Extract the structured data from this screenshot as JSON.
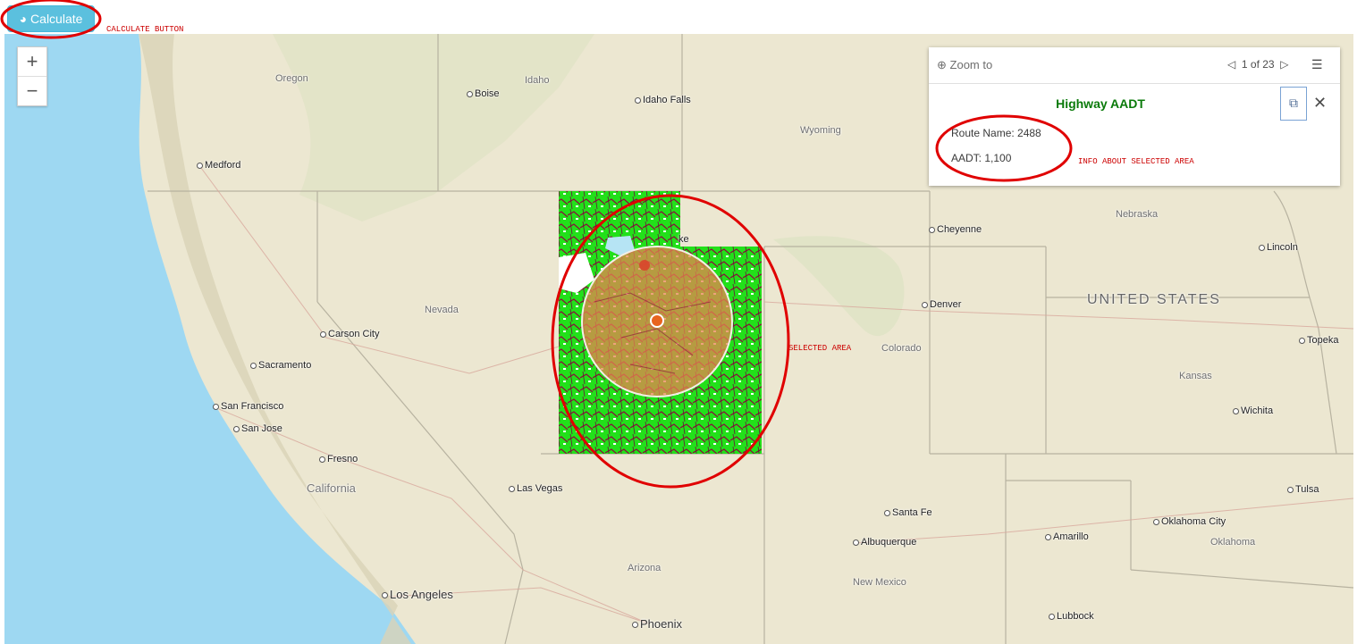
{
  "toolbar": {
    "calculate_label": "Calculate",
    "calculate_icon": "globe-icon"
  },
  "annotations": {
    "calculate_button": "CALCULATE BUTTON",
    "info": "INFO ABOUT SELECTED AREA",
    "selected_area": "SELECTED AREA"
  },
  "zoom": {
    "in": "+",
    "out": "−"
  },
  "popup": {
    "zoom_to": "Zoom to",
    "pager": "1 of 23",
    "title": "Highway AADT",
    "route_name": "Route Name: 2488",
    "aadt": "AADT: 1,100"
  },
  "map": {
    "country": "UNITED STATES",
    "states": [
      "Oregon",
      "Idaho",
      "Wyoming",
      "Nevada",
      "Nebraska",
      "Colorado",
      "Kansas",
      "California",
      "Arizona",
      "New Mexico",
      "Oklahoma"
    ],
    "cities": [
      "Boise",
      "Idaho Falls",
      "Medford",
      "Cheyenne",
      "Lincoln",
      "Denver",
      "Carson City",
      "Sacramento",
      "Topeka",
      "San Francisco",
      "San Jose",
      "Wichita",
      "Fresno",
      "Las Vegas",
      "Tulsa",
      "Santa Fe",
      "Oklahoma City",
      "Amarillo",
      "Albuquerque",
      "Los Angeles",
      "Lubbock",
      "Phoenix"
    ],
    "partial_label": "ke",
    "colors": {
      "water": "#9ed8f2",
      "land": "#ece7d1",
      "selection_fill": "#e8844f",
      "green_layer": "#22e01a",
      "roads": "#8b0a3c",
      "annotation": "#e00000"
    }
  }
}
